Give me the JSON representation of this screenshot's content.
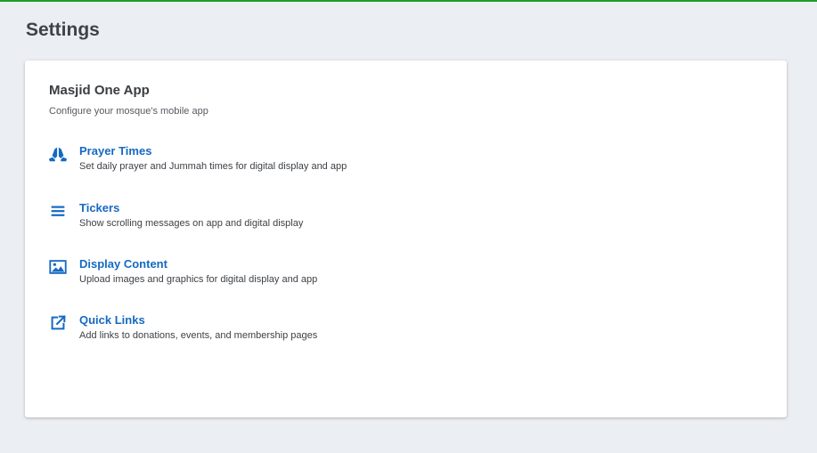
{
  "page": {
    "title": "Settings"
  },
  "colors": {
    "accent": "#1d9b2d",
    "link": "#1669c2",
    "background": "#ebeef2"
  },
  "card": {
    "title": "Masjid One App",
    "subtitle": "Configure your mosque's mobile app",
    "items": [
      {
        "icon": "praying-hands-icon",
        "label": "Prayer Times",
        "description": "Set daily prayer and Jummah times for digital display and app"
      },
      {
        "icon": "list-lines-icon",
        "label": "Tickers",
        "description": "Show scrolling messages on app and digital display"
      },
      {
        "icon": "image-icon",
        "label": "Display Content",
        "description": "Upload images and graphics for digital display and app"
      },
      {
        "icon": "external-link-icon",
        "label": "Quick Links",
        "description": "Add links to donations, events, and membership pages"
      }
    ]
  }
}
